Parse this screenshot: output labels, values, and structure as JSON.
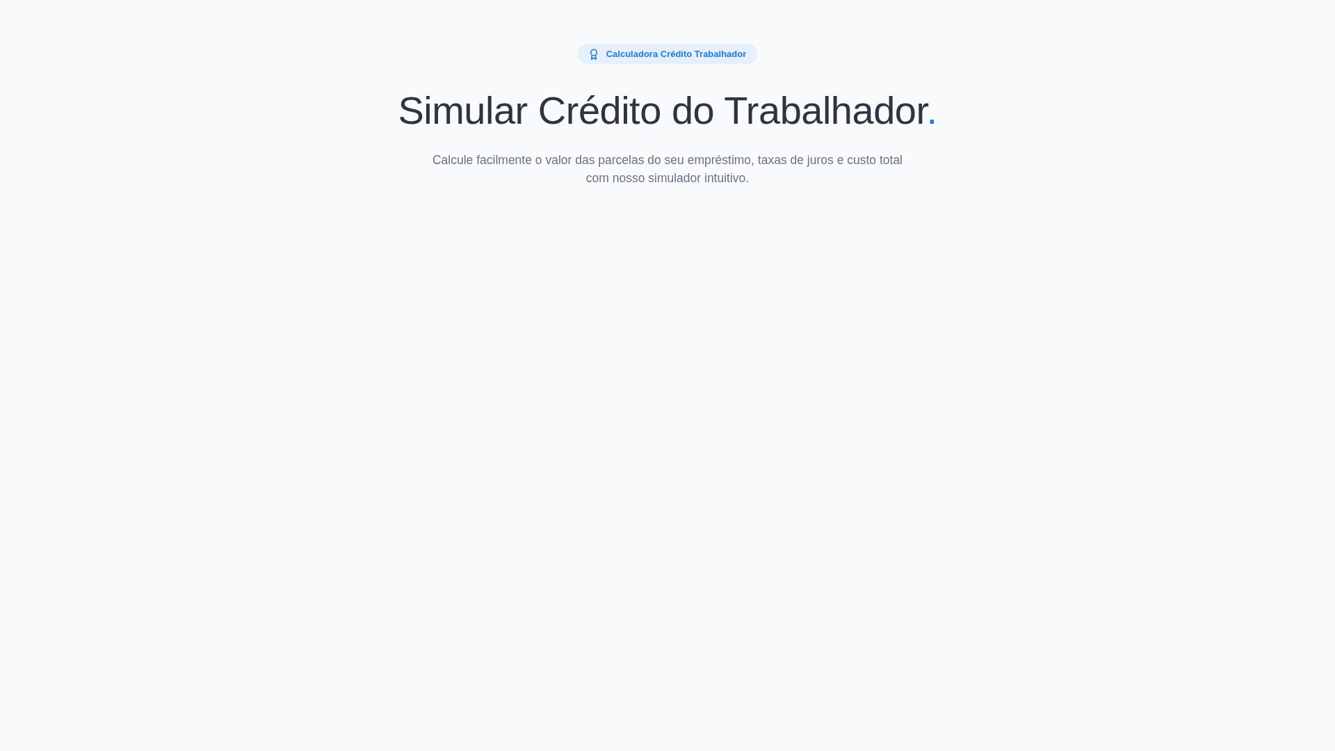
{
  "badge": {
    "label": "Calculadora Crédito Trabalhador"
  },
  "heading": {
    "title": "Simular Crédito do Trabalhador",
    "accent": "."
  },
  "subtitle": "Calcule facilmente o valor das parcelas do seu empréstimo, taxas de juros e custo total com nosso simulador intuitivo."
}
